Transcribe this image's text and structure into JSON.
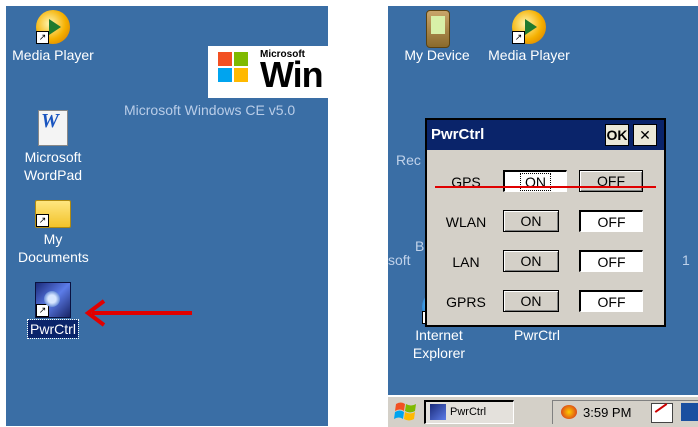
{
  "left_screen": {
    "icons": [
      {
        "label": "Media Player"
      },
      {
        "label": "Microsoft WordPad"
      },
      {
        "label": "My Documents"
      },
      {
        "label": "PwrCtrl"
      }
    ],
    "logo": {
      "brand_small": "Microsoft",
      "brand_large": "Win"
    },
    "os_text": "Microsoft Windows CE v5.0"
  },
  "right_screen": {
    "icons": [
      {
        "label": "My Device"
      },
      {
        "label": "Media Player"
      },
      {
        "label": "Internet Explorer"
      },
      {
        "label": "PwrCtrl"
      }
    ],
    "partial_texts": [
      "Rec",
      "B",
      "soft",
      "1"
    ],
    "dialog": {
      "title": "PwrCtrl",
      "ok_label": "OK",
      "close_label": "✕",
      "rows": [
        {
          "name": "GPS",
          "on_label": "ON",
          "off_label": "OFF",
          "state": "on"
        },
        {
          "name": "WLAN",
          "on_label": "ON",
          "off_label": "OFF",
          "state": "off"
        },
        {
          "name": "LAN",
          "on_label": "ON",
          "off_label": "OFF",
          "state": "off"
        },
        {
          "name": "GPRS",
          "on_label": "ON",
          "off_label": "OFF",
          "state": "off"
        }
      ]
    },
    "taskbar": {
      "task_label": "PwrCtrl",
      "clock": "3:59 PM"
    }
  },
  "colors": {
    "desktop": "#3a6ea5",
    "annotation": "#e00000",
    "titlebar": "#0a246a"
  }
}
